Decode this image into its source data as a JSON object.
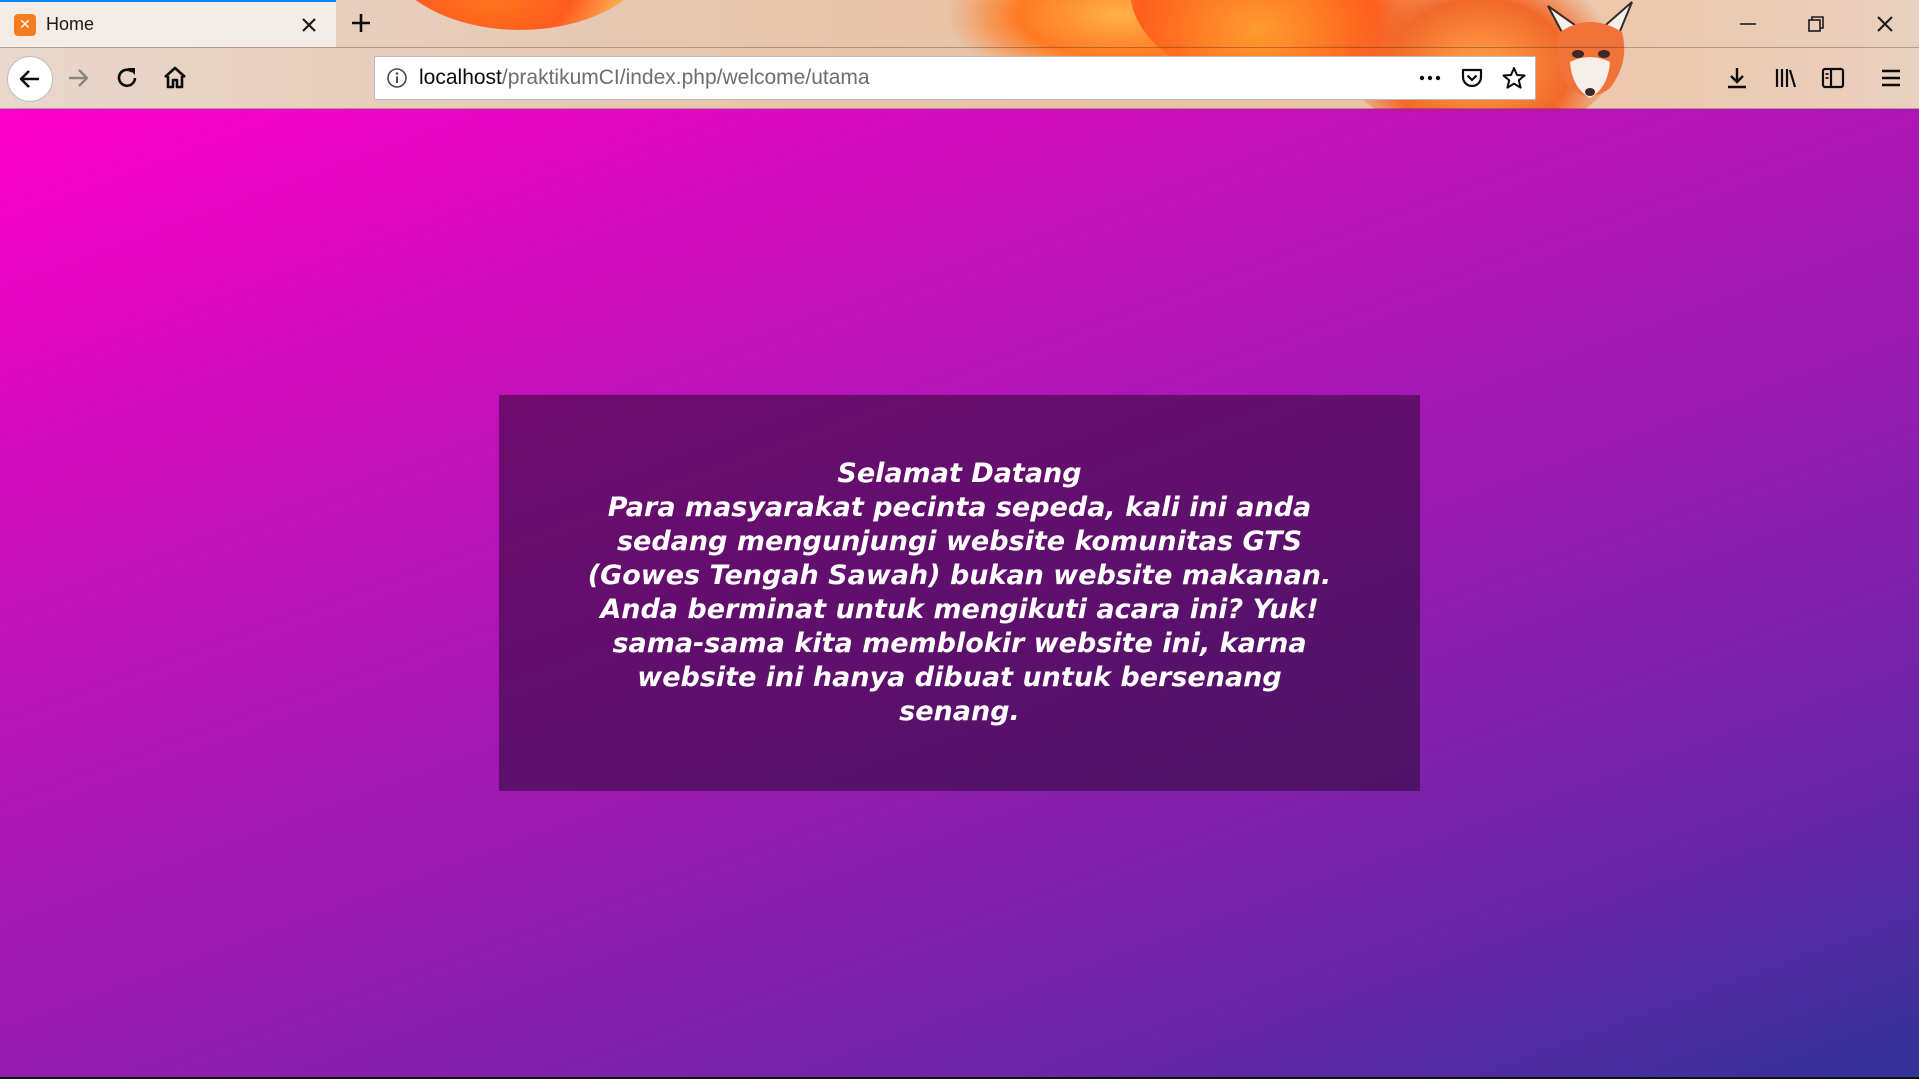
{
  "tab": {
    "title": "Home",
    "favicon": "xampp-favicon-icon"
  },
  "window_controls": {
    "minimize": "minimize-icon",
    "maximize": "restore-icon",
    "close": "close-icon"
  },
  "navigation": {
    "back": "back-arrow-icon",
    "forward": "forward-arrow-icon",
    "reload": "reload-icon",
    "home": "home-icon"
  },
  "urlbar": {
    "host": "localhost",
    "path": "/praktikumCI/index.php/welcome/utama",
    "info_icon": "info-icon",
    "actions": [
      "more-actions-icon",
      "pocket-icon",
      "bookmark-star-icon"
    ]
  },
  "toolbar": {
    "icons": [
      "download-icon",
      "library-icon",
      "sidebar-icon",
      "menu-icon"
    ]
  },
  "page": {
    "heading": "Selamat Datang",
    "body": "Para masyarakat pecinta sepeda, kali ini anda sedang mengunjungi website komunitas GTS (Gowes Tengah Sawah) bukan website makanan. Anda berminat untuk mengikuti acara ini? Yuk! sama-sama kita memblokir website ini, karna website ini hanya dibuat untuk bersenang senang.",
    "colors": {
      "gradient_start": "#ff00cc",
      "gradient_end": "#333399",
      "box_background": "#4a1552",
      "text": "#ffffff"
    }
  }
}
